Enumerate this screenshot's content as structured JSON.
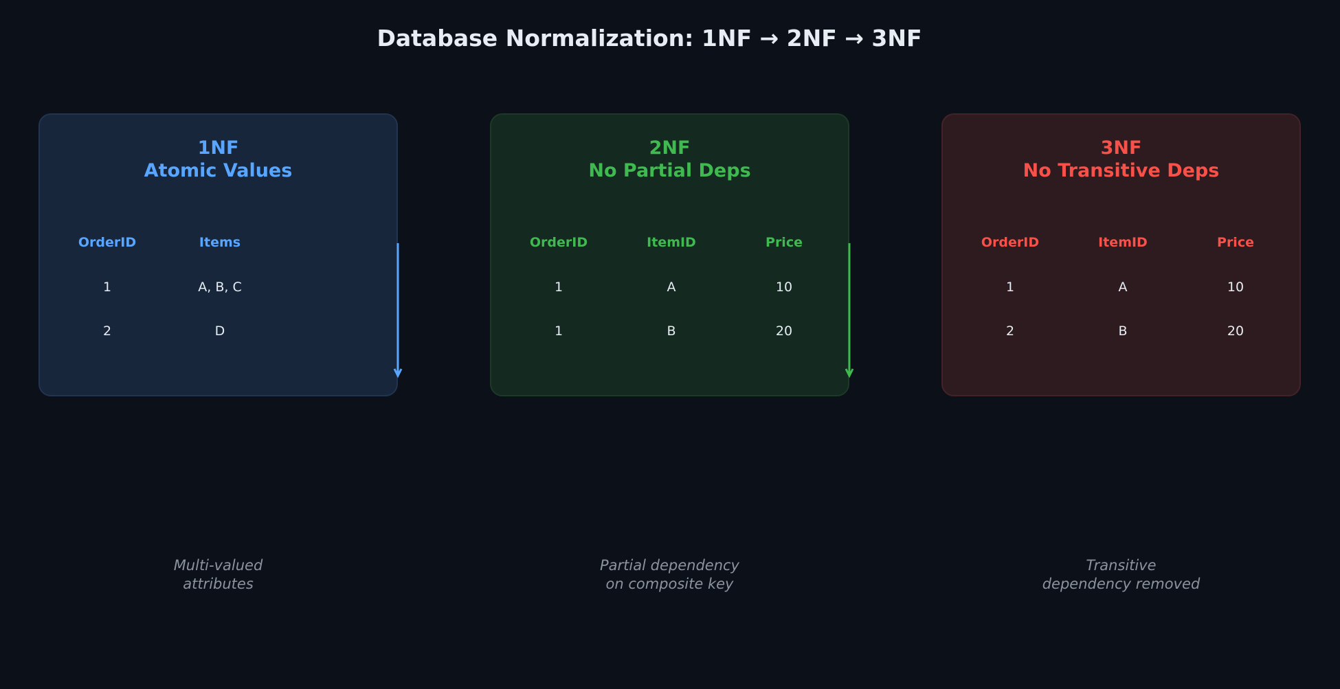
{
  "title": "Database Normalization: 1NF → 2NF → 3NF",
  "colors": {
    "background": "#0c1018",
    "blue": "#58a6ff",
    "green": "#3fb950",
    "red": "#f85149",
    "text": "#e6edf3",
    "muted": "#8b949e"
  },
  "panels": [
    {
      "name": "1nf",
      "title_line1": "1NF",
      "title_line2": "Atomic Values",
      "accent": "#58a6ff",
      "fill": "#17263b",
      "border": "#22344f",
      "headers": [
        "OrderID",
        "Items"
      ],
      "rows": [
        [
          "1",
          "A, B, C"
        ],
        [
          "2",
          "D"
        ]
      ],
      "note_line1": "Multi-valued",
      "note_line2": "attributes"
    },
    {
      "name": "2nf",
      "title_line1": "2NF",
      "title_line2": "No Partial Deps",
      "accent": "#3fb950",
      "fill": "#142920",
      "border": "#1c3a27",
      "headers": [
        "OrderID",
        "ItemID",
        "Price"
      ],
      "rows": [
        [
          "1",
          "A",
          "10"
        ],
        [
          "1",
          "B",
          "20"
        ]
      ],
      "note_line1": "Partial dependency",
      "note_line2": "on composite key"
    },
    {
      "name": "3nf",
      "title_line1": "3NF",
      "title_line2": "No Transitive Deps",
      "accent": "#f85149",
      "fill": "#2e1b1f",
      "border": "#432328",
      "headers": [
        "OrderID",
        "ItemID",
        "Price"
      ],
      "rows": [
        [
          "1",
          "A",
          "10"
        ],
        [
          "2",
          "B",
          "20"
        ]
      ],
      "note_line1": "Transitive",
      "note_line2": "dependency removed"
    }
  ]
}
